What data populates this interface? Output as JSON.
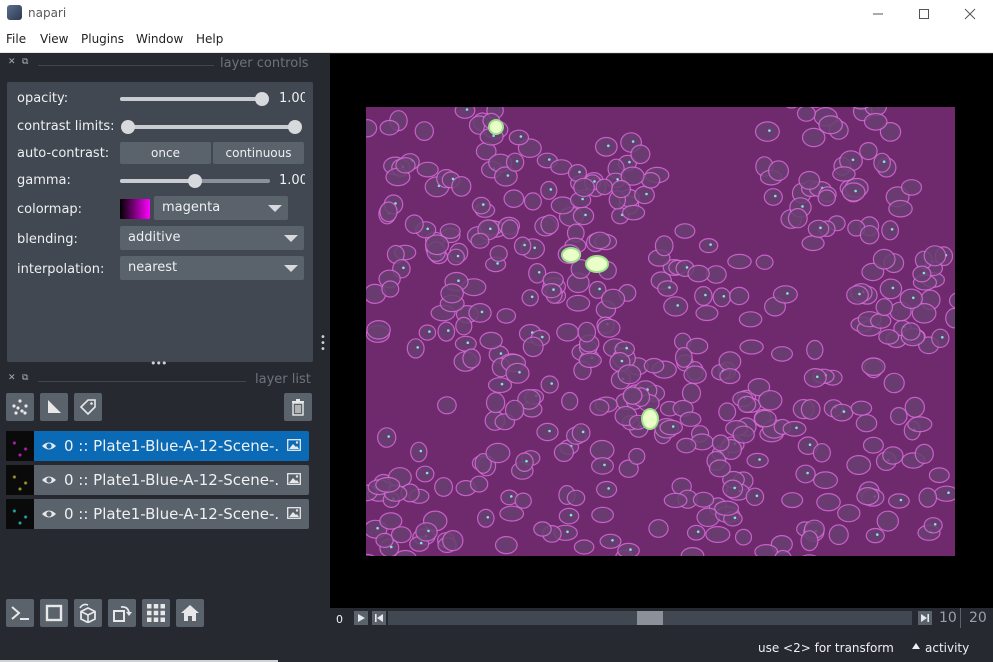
{
  "window": {
    "title": "napari",
    "minimize": "—",
    "maximize": "☐",
    "close": "✕"
  },
  "menu": {
    "items": [
      "File",
      "View",
      "Plugins",
      "Window",
      "Help"
    ]
  },
  "layer_controls": {
    "header": "layer controls",
    "opacity_label": "opacity:",
    "opacity_value": "1.00",
    "opacity_level": 1.0,
    "contrast_label": "contrast limits:",
    "contrast_range": [
      0.0,
      1.0
    ],
    "autocontrast_label": "auto-contrast:",
    "once_label": "once",
    "continuous_label": "continuous",
    "gamma_label": "gamma:",
    "gamma_value": "1.00",
    "gamma_level": 0.5,
    "colormap_label": "colormap:",
    "colormap_value": "magenta",
    "blending_label": "blending:",
    "blending_value": "additive",
    "interpolation_label": "interpolation:",
    "interpolation_value": "nearest"
  },
  "layer_list": {
    "header": "layer list",
    "layers": [
      {
        "name": "0 :: Plate1-Blue-A-12-Scene-...",
        "selected": true,
        "thumb_color": "#b21fb2"
      },
      {
        "name": "0 :: Plate1-Blue-A-12-Scene-...",
        "selected": false,
        "thumb_color": "#9a9a2a"
      },
      {
        "name": "0 :: Plate1-Blue-A-12-Scene-...",
        "selected": false,
        "thumb_color": "#1fa6a6"
      }
    ]
  },
  "dims": {
    "start": "0",
    "current": "10",
    "end": "20",
    "position_fraction": 0.5
  },
  "status": {
    "hint": "use <2> for transform",
    "activity": "activity"
  },
  "colors": {
    "accent": "#0a6ab6",
    "panel": "#414851",
    "background": "#262930",
    "image_tint": "#6f2a6e"
  }
}
